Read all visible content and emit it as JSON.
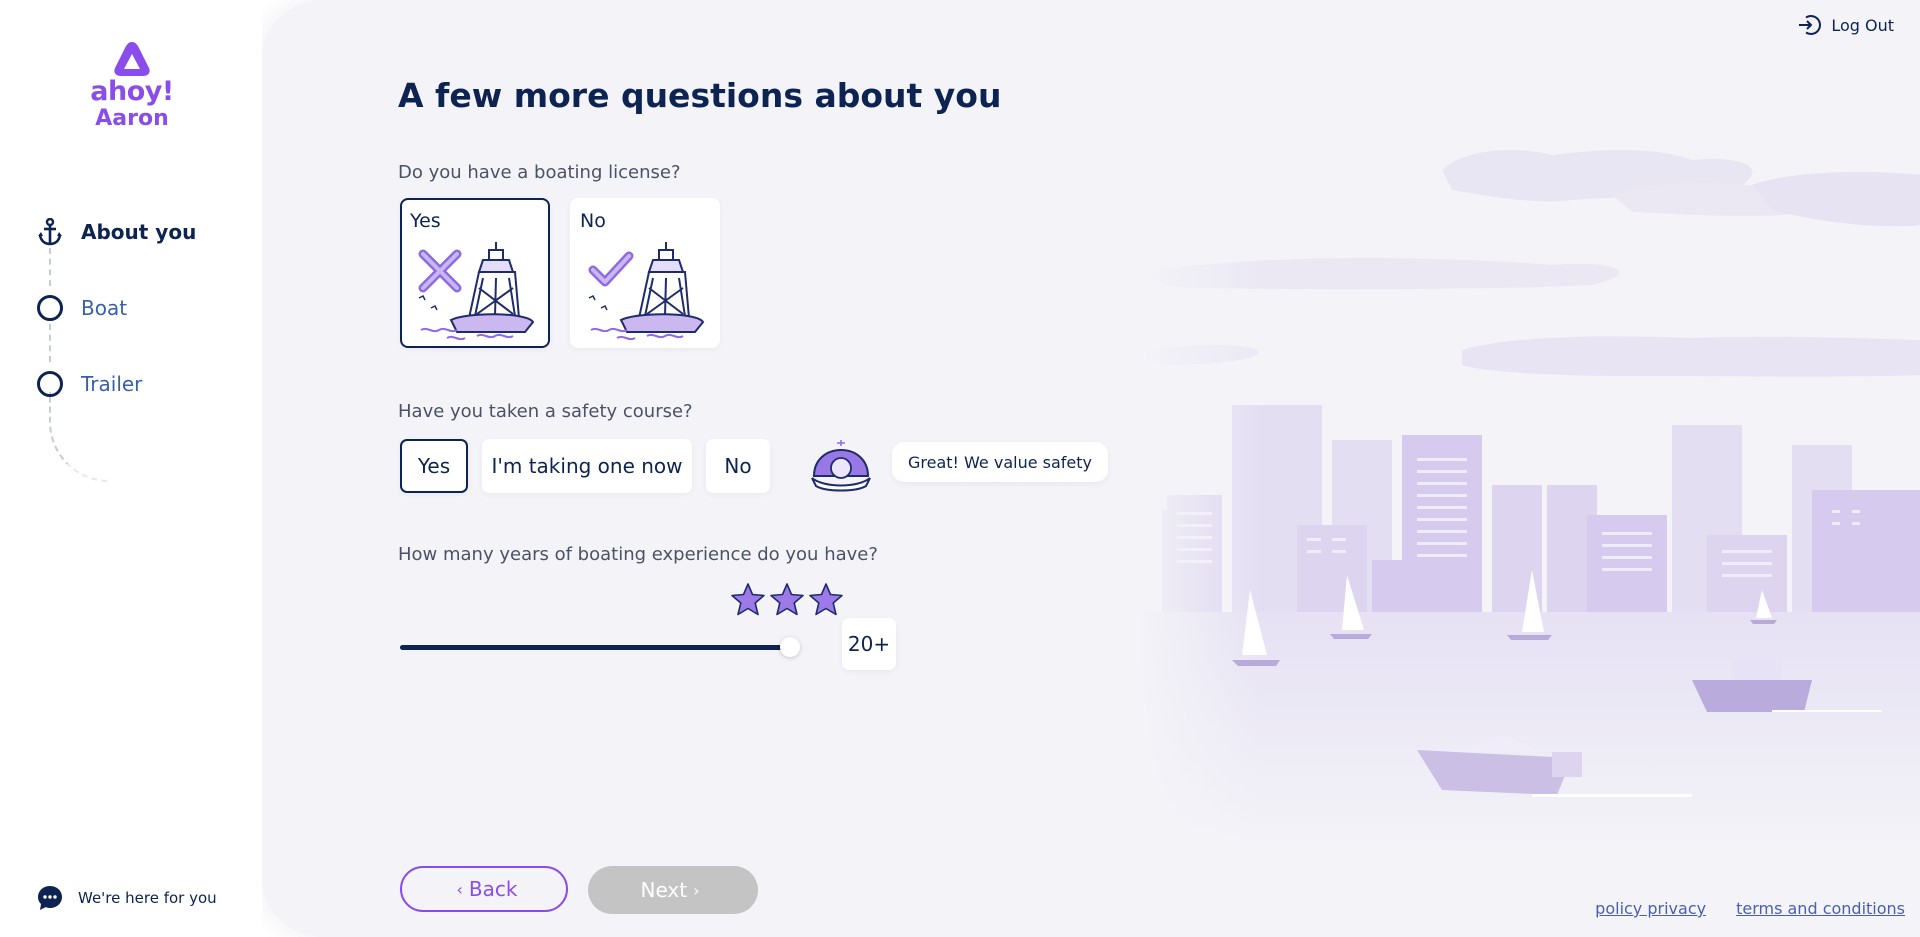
{
  "brand": {
    "wordmark": "ahoy!",
    "user_name": "Aaron",
    "color": "#8a4cea"
  },
  "sidebar": {
    "steps": [
      {
        "label": "About you",
        "icon": "anchor-icon",
        "state": "current"
      },
      {
        "label": "Boat",
        "icon": "circle-icon",
        "state": "pending"
      },
      {
        "label": "Trailer",
        "icon": "circle-icon",
        "state": "pending"
      }
    ],
    "help_label": "We're here for you"
  },
  "header": {
    "logout_label": "Log Out"
  },
  "page": {
    "title": "A few more questions about you",
    "license": {
      "question": "Do you have a boating license?",
      "options": [
        {
          "label": "Yes",
          "selected": true
        },
        {
          "label": "No",
          "selected": false
        }
      ]
    },
    "safety": {
      "question": "Have you taken a safety course?",
      "options": [
        {
          "label": "Yes",
          "selected": true
        },
        {
          "label": "I'm taking one now",
          "selected": false
        },
        {
          "label": "No",
          "selected": false
        }
      ],
      "feedback": "Great! We value safety"
    },
    "experience": {
      "question": "How many years of boating experience do you have?",
      "value_label": "20+",
      "slider_fraction": 1.0,
      "stars": 3
    }
  },
  "buttons": {
    "back": "Back",
    "next": "Next"
  },
  "footer": {
    "policy": "policy privacy",
    "terms": "terms and conditions"
  },
  "colors": {
    "navy": "#0d2452",
    "accent": "#8a4cea",
    "panel": "#f4f4f8",
    "disabled": "#c4c4c4"
  }
}
